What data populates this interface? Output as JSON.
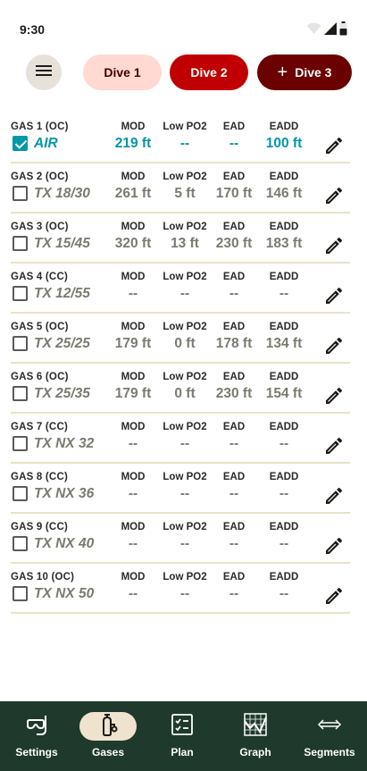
{
  "status_bar": {
    "time": "9:30"
  },
  "dive_tabs": [
    {
      "label": "Dive 1"
    },
    {
      "label": "Dive 2"
    },
    {
      "label": "Dive 3",
      "prefix": "+"
    }
  ],
  "selected_dive": "Dive 2",
  "gases": [
    {
      "title": "GAS 1 (OC)",
      "name": "AIR",
      "checked": true,
      "mod_label": "MOD",
      "lpo2_label": "Low PO2",
      "ead_label": "EAD",
      "eadd_label": "EADD",
      "mod": "219 ft",
      "lpo2": "--",
      "ead": "--",
      "eadd": "100 ft"
    },
    {
      "title": "GAS 2 (OC)",
      "name": "TX 18/30",
      "checked": false,
      "mod_label": "MOD",
      "lpo2_label": "Low PO2",
      "ead_label": "EAD",
      "eadd_label": "EADD",
      "mod": "261 ft",
      "lpo2": "5 ft",
      "ead": "170 ft",
      "eadd": "146 ft"
    },
    {
      "title": "GAS 3 (OC)",
      "name": "TX 15/45",
      "checked": false,
      "mod_label": "MOD",
      "lpo2_label": "Low PO2",
      "ead_label": "EAD",
      "eadd_label": "EADD",
      "mod": "320 ft",
      "lpo2": "13 ft",
      "ead": "230 ft",
      "eadd": "183 ft"
    },
    {
      "title": "GAS 4 (CC)",
      "name": "TX 12/55",
      "checked": false,
      "mod_label": "MOD",
      "lpo2_label": "Low PO2",
      "ead_label": "EAD",
      "eadd_label": "EADD",
      "mod": "--",
      "lpo2": "--",
      "ead": "--",
      "eadd": "--"
    },
    {
      "title": "GAS 5 (OC)",
      "name": "TX 25/25",
      "checked": false,
      "mod_label": "MOD",
      "lpo2_label": "Low PO2",
      "ead_label": "EAD",
      "eadd_label": "EADD",
      "mod": "179 ft",
      "lpo2": "0 ft",
      "ead": "178 ft",
      "eadd": "134 ft"
    },
    {
      "title": "GAS 6 (OC)",
      "name": "TX 25/35",
      "checked": false,
      "mod_label": "MOD",
      "lpo2_label": "Low PO2",
      "ead_label": "EAD",
      "eadd_label": "EADD",
      "mod": "179 ft",
      "lpo2": "0 ft",
      "ead": "230 ft",
      "eadd": "154 ft"
    },
    {
      "title": "GAS 7 (CC)",
      "name": "TX NX 32",
      "checked": false,
      "mod_label": "MOD",
      "lpo2_label": "Low PO2",
      "ead_label": "EAD",
      "eadd_label": "EADD",
      "mod": "--",
      "lpo2": "--",
      "ead": "--",
      "eadd": "--"
    },
    {
      "title": "GAS 8 (CC)",
      "name": "TX NX 36",
      "checked": false,
      "mod_label": "MOD",
      "lpo2_label": "Low PO2",
      "ead_label": "EAD",
      "eadd_label": "EADD",
      "mod": "--",
      "lpo2": "--",
      "ead": "--",
      "eadd": "--"
    },
    {
      "title": "GAS 9 (CC)",
      "name": "TX NX 40",
      "checked": false,
      "mod_label": "MOD",
      "lpo2_label": "Low PO2",
      "ead_label": "EAD",
      "eadd_label": "EADD",
      "mod": "--",
      "lpo2": "--",
      "ead": "--",
      "eadd": "--"
    },
    {
      "title": "GAS 10 (OC)",
      "name": "TX NX 50",
      "checked": false,
      "mod_label": "MOD",
      "lpo2_label": "Low PO2",
      "ead_label": "EAD",
      "eadd_label": "EADD",
      "mod": "--",
      "lpo2": "--",
      "ead": "--",
      "eadd": "--"
    }
  ],
  "bottom_nav": [
    {
      "label": "Settings",
      "icon": "snorkel-mask-icon"
    },
    {
      "label": "Gases",
      "icon": "gas-tank-icon",
      "active": true
    },
    {
      "label": "Plan",
      "icon": "checklist-icon"
    },
    {
      "label": "Graph",
      "icon": "chart-grid-icon"
    },
    {
      "label": "Segments",
      "icon": "double-arrow-icon"
    }
  ],
  "colors": {
    "accent_teal": "#0097a7",
    "dive1_bg": "#ffd9d2",
    "dive2_bg": "#c00000",
    "dive3_bg": "#6b0000",
    "nav_bg": "#1f3a2c",
    "nav_active_pill": "#efe3cf",
    "row_divider": "#e8e3c9"
  }
}
